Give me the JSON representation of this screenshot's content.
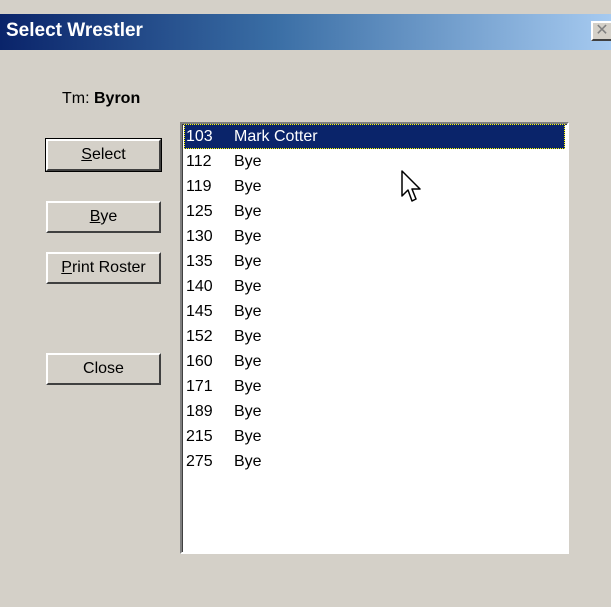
{
  "window": {
    "title": "Select Wrestler",
    "close_glyph": "✕"
  },
  "team": {
    "label": "Tm:",
    "name": "Byron"
  },
  "buttons": {
    "select": {
      "mnemonic": "S",
      "rest": "elect"
    },
    "bye": {
      "mnemonic": "B",
      "rest": "ye"
    },
    "print_roster": {
      "mnemonic": "P",
      "rest": "rint Roster"
    },
    "close": "Close"
  },
  "roster": {
    "selected_index": 0,
    "items": [
      {
        "weight": "103",
        "name": "Mark Cotter"
      },
      {
        "weight": "112",
        "name": "Bye"
      },
      {
        "weight": "119",
        "name": "Bye"
      },
      {
        "weight": "125",
        "name": "Bye"
      },
      {
        "weight": "130",
        "name": "Bye"
      },
      {
        "weight": "135",
        "name": "Bye"
      },
      {
        "weight": "140",
        "name": "Bye"
      },
      {
        "weight": "145",
        "name": "Bye"
      },
      {
        "weight": "152",
        "name": "Bye"
      },
      {
        "weight": "160",
        "name": "Bye"
      },
      {
        "weight": "171",
        "name": "Bye"
      },
      {
        "weight": "189",
        "name": "Bye"
      },
      {
        "weight": "215",
        "name": "Bye"
      },
      {
        "weight": "275",
        "name": "Bye"
      }
    ]
  },
  "colors": {
    "selection_bg": "#0a246a",
    "title_gradient_start": "#0a246a",
    "title_gradient_end": "#a6caf0",
    "dialog_face": "#d4d0c8"
  },
  "icons": {
    "close": "close-icon",
    "cursor": "mouse-pointer-icon"
  }
}
